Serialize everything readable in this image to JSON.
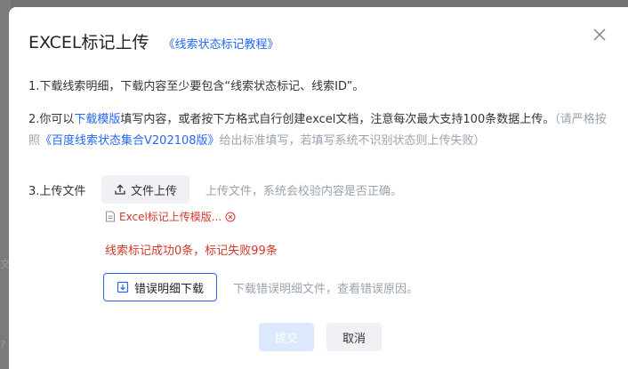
{
  "dialog": {
    "title": "EXCEL标记上传",
    "tutorial_link": "《线索状态标记教程》",
    "close_icon": "close-icon"
  },
  "instructions": {
    "line1": "1.下载线索明细，下载内容至少要包含“线索状态标记、线索ID”。",
    "line2_prefix": "2.你可以",
    "line2_link": "下载模版",
    "line2_middle": "填写内容，或者按下方格式自行创建excel文档，注意每次最大支持100条数据上传。",
    "line2_note_open": "（请严格按照",
    "line2_note_link": "《百度线索状态集合V202108版》",
    "line2_note_close": "给出标准填写，若填写系统不识别状态则上传失败）"
  },
  "upload": {
    "label": "3.上传文件",
    "button_label": "文件上传",
    "hint": "上传文件，系统会校验内容是否正确。",
    "file_name": "Excel标记上传模版..."
  },
  "result": {
    "message": "线索标记成功0条，标记失败99条"
  },
  "error_download": {
    "button_label": "错误明细下载",
    "hint": "下载错误明细文件，查看错误原因。"
  },
  "footer": {
    "submit_label": "提交",
    "cancel_label": "取消"
  },
  "background": {
    "hint_chars": [
      "文",
      "?"
    ]
  },
  "colors": {
    "accent": "#2468f2",
    "error": "#d1392b",
    "muted": "#9aa3ad",
    "submit_disabled": "#dbe8fd"
  }
}
